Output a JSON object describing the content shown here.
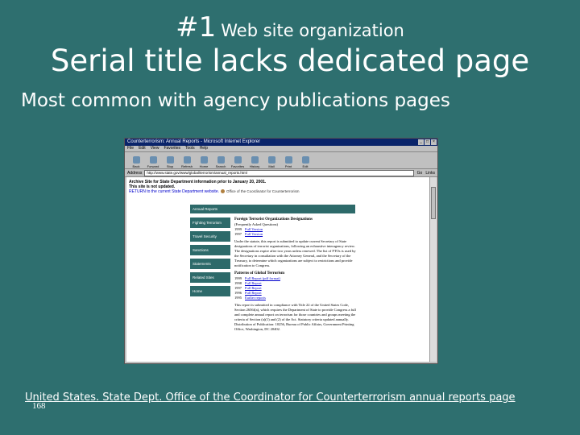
{
  "slide": {
    "title_number": "#1",
    "title_suffix": "Web site organization",
    "subtitle": "Serial title lacks dedicated page",
    "bullet": "Most common with agency publications pages",
    "citation": "United States. State Dept. Office of the Coordinator for Counterterrorism annual reports page",
    "page_number": "168"
  },
  "browser": {
    "window_title": "Counterterrorism: Annual Reports - Microsoft Internet Explorer",
    "menu": [
      "File",
      "Edit",
      "View",
      "Favorites",
      "Tools",
      "Help"
    ],
    "toolbar": [
      "Back",
      "Forward",
      "Stop",
      "Refresh",
      "Home",
      "Search",
      "Favorites",
      "History",
      "Mail",
      "Print",
      "Edit"
    ],
    "address_label": "Address",
    "address_value": "http://www.state.gov/www/global/terrorism/annual_reports.html",
    "go_label": "Go",
    "links_label": "Links"
  },
  "page": {
    "notice_line1": "Archive Site for State Department information prior to January 20, 2001.",
    "notice_line2": "This site is not updated.",
    "notice_line3": "RETURN to the current State Department website.",
    "seal_text": "Office of the Coordinator for Counterterrorism",
    "nav_header": "Annual Reports",
    "nav": [
      "Fighting Terrorism",
      "Travel Security",
      "Sanctions",
      "Statements",
      "Related Sites",
      "Home"
    ],
    "section1_title": "Foreign Terrorist Organizations Designations",
    "section1_note": "(Frequently Asked Questions)",
    "section1_years": [
      {
        "year": "1999",
        "label": "Full Version"
      },
      {
        "year": "1997",
        "label": "Full Version"
      }
    ],
    "section1_para": "Under the statute, this report is submitted to update current Secretary of State designations of terrorist organizations, following an exhaustive interagency review. The designations expire after two years unless renewed. The list of FTOs is used by the Secretary in consultation with the Attorney General, and the Secretary of the Treasury, to determine which organizations are subject to restrictions and provide notification to Congress.",
    "section2_title": "Patterns of Global Terrorism",
    "section2_years": [
      {
        "year": "1999",
        "label": "Full Report (pdf format)"
      },
      {
        "year": "1998",
        "label": "Full Report"
      },
      {
        "year": "1997",
        "label": "Full Report"
      },
      {
        "year": "1996",
        "label": "Full Report"
      },
      {
        "year": "1995",
        "label": "Earlier reports"
      }
    ],
    "section2_para": "This report is submitted in compliance with Title 22 of the United States Code, Section 2656f(a), which requires the Department of State to provide Congress a full and complete annual report on terrorism for those countries and groups meeting the criteria of Section (a)(1) and (2) of the Act. Statutory criteria updated annually. Distribution of Publication: 10256, Bureau of Public Affairs, Government Printing Office, Washington, DC 20402."
  },
  "colors": {
    "slide_background": "#2e6f6f",
    "nav_background": "#2d6a6a",
    "titlebar": "#0a246a"
  }
}
